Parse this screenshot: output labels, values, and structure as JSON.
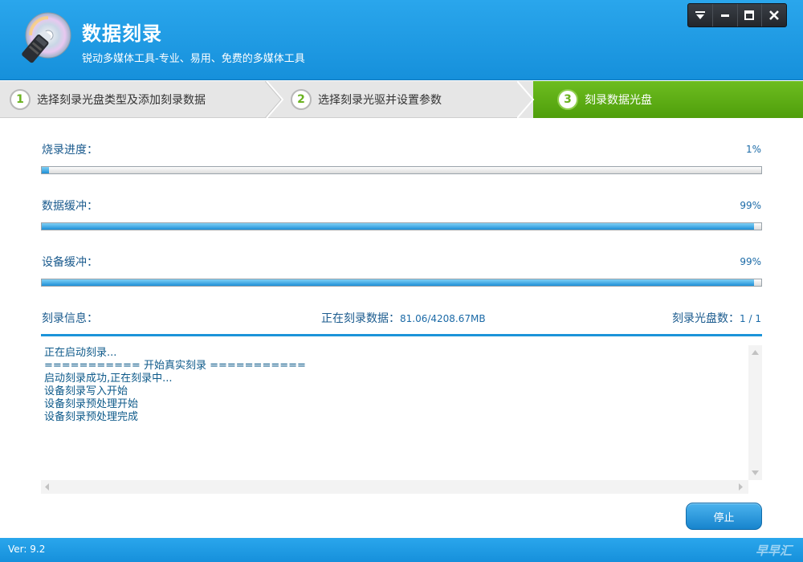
{
  "app": {
    "title": "数据刻录",
    "subtitle": "锐动多媒体工具-专业、易用、免费的多媒体工具",
    "window_controls": [
      "menu-icon",
      "minimize-icon",
      "maximize-icon",
      "close-icon"
    ]
  },
  "steps": [
    {
      "num": "1",
      "label": "选择刻录光盘类型及添加刻录数据",
      "active": false
    },
    {
      "num": "2",
      "label": "选择刻录光驱并设置参数",
      "active": false
    },
    {
      "num": "3",
      "label": "刻录数据光盘",
      "active": true
    }
  ],
  "progress": {
    "burn": {
      "label": "烧录进度：",
      "value_text": "1%",
      "value": 1
    },
    "data_buffer": {
      "label": "数据缓冲：",
      "value_text": "99%",
      "value": 99
    },
    "device_buffer": {
      "label": "设备缓冲：",
      "value_text": "99%",
      "value": 99
    }
  },
  "info": {
    "label": "刻录信息：",
    "burning_label": "正在刻录数据：",
    "burning_value": "81.06/4208.67MB",
    "disc_count_label": "刻录光盘数：",
    "disc_count_value": "1 / 1"
  },
  "log": [
    "正在启动刻录...",
    "=========== 开始真实刻录 ===========",
    "启动刻录成功,正在刻录中...",
    "设备刻录写入开始",
    "设备刻录预处理开始",
    "设备刻录预处理完成"
  ],
  "buttons": {
    "stop": "停止"
  },
  "footer": {
    "version": "Ver: 9.2",
    "watermark": "早早汇"
  },
  "colors": {
    "primary": "#1c94d9",
    "active_step": "#5aa814",
    "text": "#1b5b8e"
  }
}
